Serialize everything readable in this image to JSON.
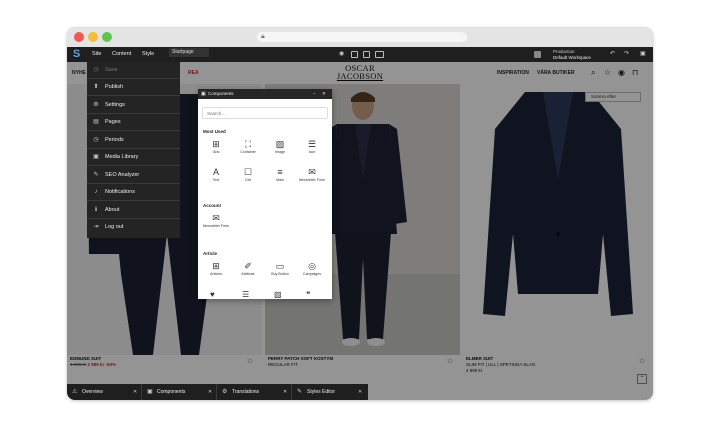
{
  "cms": {
    "logo": "S",
    "menu": [
      "Site",
      "Content",
      "Style"
    ],
    "tab": "Startpage",
    "workspace_line1": "Production",
    "workspace_line2": "Default Workspace"
  },
  "site_menu": {
    "items": [
      {
        "icon": "◷",
        "label": "Save",
        "dim": true
      },
      {
        "icon": "⬆",
        "label": "Publish"
      },
      {
        "icon": "⚙",
        "label": "Settings"
      },
      {
        "icon": "▤",
        "label": "Pages"
      },
      {
        "icon": "◷",
        "label": "Periods"
      },
      {
        "icon": "▣",
        "label": "Media Library"
      },
      {
        "icon": "✎",
        "label": "SEO Analyzer"
      },
      {
        "icon": "♪",
        "label": "Notifications"
      },
      {
        "icon": "ℹ",
        "label": "About"
      },
      {
        "icon": "⇥",
        "label": "Log out"
      }
    ]
  },
  "site": {
    "nav_left": "NYHE",
    "nav_sale": "REA",
    "brand_line1": "OSCAR",
    "brand_line2": "JACOBSON",
    "nav_right": [
      "INSPIRATION",
      "VÅRA BUTIKER"
    ],
    "sort_label": "Sortera efter"
  },
  "products": [
    {
      "name": "EDMUND SUIT",
      "old_price": "4 999 kr",
      "new_price": "2 999 kr",
      "discount": "-60%"
    },
    {
      "name": "PERRY PATCH SOFT KOSTYM",
      "subtitle": "REGULAR FIT"
    },
    {
      "name": "ELMER SUIT",
      "subtitle": "SLIM FIT | ULL | SPETSIGA SLAG",
      "price": "4 999 kr"
    }
  ],
  "components": {
    "title": "Components",
    "search_placeholder": "Search...",
    "sections": {
      "most_used": "Most Used",
      "account": "Account",
      "article": "Article"
    },
    "most_used_items": [
      {
        "icon": "⊞",
        "label": "Grid"
      },
      {
        "icon": "⛶",
        "label": "Container"
      },
      {
        "icon": "▨",
        "label": "Image"
      },
      {
        "icon": "☰",
        "label": "Icon"
      },
      {
        "icon": "A",
        "label": "Text"
      },
      {
        "icon": "☐",
        "label": "Cell"
      },
      {
        "icon": "≡",
        "label": "Main"
      },
      {
        "icon": "✉",
        "label": "Newsletter Form"
      }
    ],
    "account_items": [
      {
        "icon": "✉",
        "label": "Newsletter Form"
      }
    ],
    "article_items": [
      {
        "icon": "⊞",
        "label": "Articles"
      },
      {
        "icon": "✐",
        "label": "Attribute"
      },
      {
        "icon": "▭",
        "label": "Buy Button"
      },
      {
        "icon": "◎",
        "label": "Campaigns"
      }
    ]
  },
  "bottom_tabs": [
    {
      "icon": "⚠",
      "label": "Overview"
    },
    {
      "icon": "▣",
      "label": "Components"
    },
    {
      "icon": "⚙",
      "label": "Translations"
    },
    {
      "icon": "✎",
      "label": "Styles Editor"
    }
  ],
  "colors": {
    "cms_bar": "#1f1f1f",
    "accent_logo": "#5ba5e6",
    "sale_red": "#c3302e"
  }
}
